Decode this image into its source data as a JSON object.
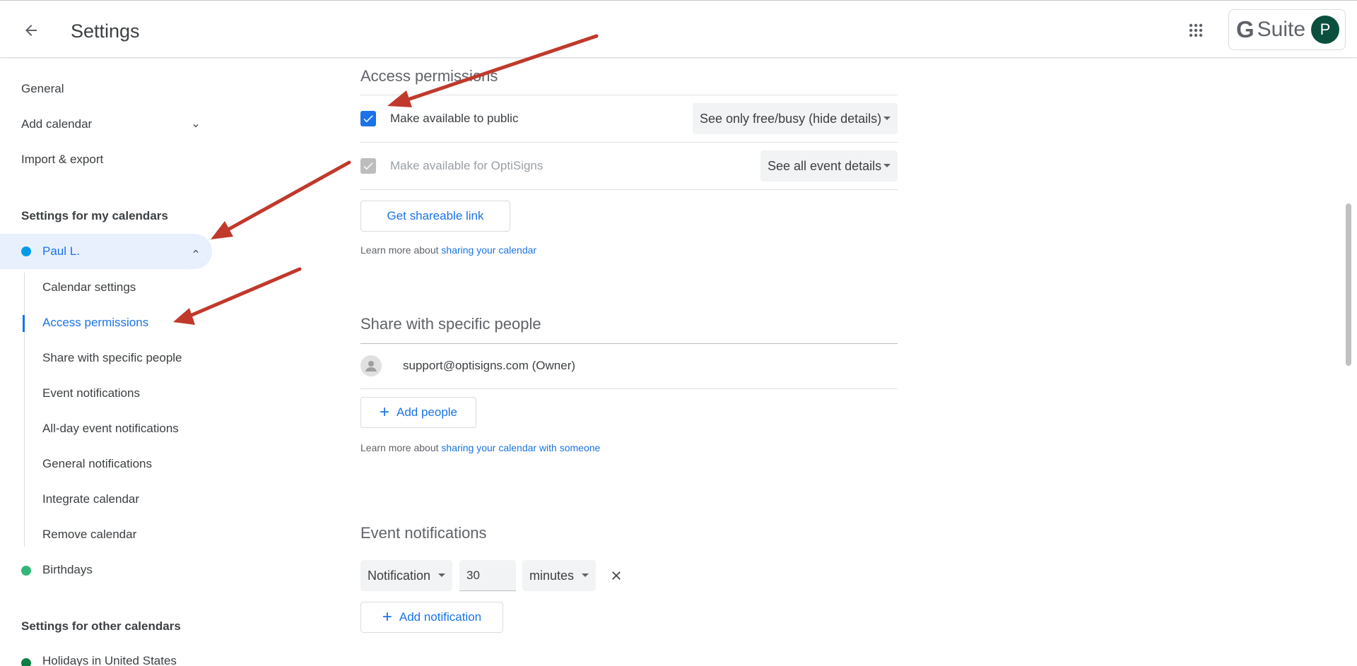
{
  "header": {
    "title": "Settings",
    "brand_g": "G",
    "brand_text": "Suite",
    "avatar_initial": "P"
  },
  "sidebar": {
    "general": "General",
    "add_calendar": "Add calendar",
    "import_export": "Import & export",
    "my_calendars_title": "Settings for my calendars",
    "my_calendar": {
      "name": "Paul L.",
      "color": "#039be5"
    },
    "sub_items": [
      "Calendar settings",
      "Access permissions",
      "Share with specific people",
      "Event notifications",
      "All-day event notifications",
      "General notifications",
      "Integrate calendar",
      "Remove calendar"
    ],
    "birthdays": {
      "name": "Birthdays",
      "color": "#33b679"
    },
    "other_calendars_title": "Settings for other calendars",
    "holidays": {
      "name": "Holidays in United States",
      "color": "#0b8043"
    }
  },
  "access": {
    "title": "Access permissions",
    "public_label": "Make available to public",
    "public_checked": true,
    "public_select": "See only free/busy (hide details)",
    "org_label": "Make available for OptiSigns",
    "org_checked": true,
    "org_disabled": true,
    "org_select": "See all event details",
    "shareable_link": "Get shareable link",
    "learn_prefix": "Learn more about",
    "learn_link": "sharing your calendar"
  },
  "share": {
    "title": "Share with specific people",
    "person": "support@optisigns.com (Owner)",
    "add_people": "Add people",
    "learn_prefix": "Learn more about",
    "learn_link": "sharing your calendar with someone"
  },
  "notifications": {
    "title": "Event notifications",
    "type": "Notification",
    "value": "30",
    "unit": "minutes",
    "add_notification": "Add notification"
  },
  "colors": {
    "accent": "#1a73e8",
    "annotation_arrow": "#c0392b"
  }
}
